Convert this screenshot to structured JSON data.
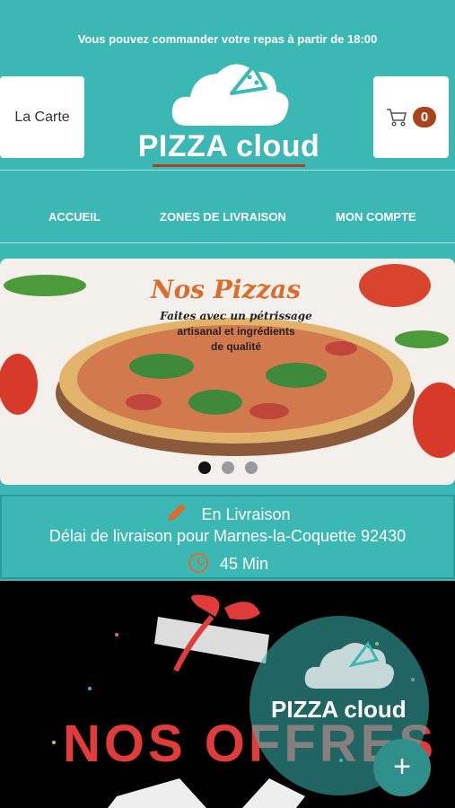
{
  "header": {
    "notice": "Vous pouvez commander votre repas à partir de 18:00",
    "menu_button": "La Carte",
    "cart_count": "0",
    "cart_icon": "cart-icon",
    "logo_text": "PIZZA cloud"
  },
  "nav": {
    "items": [
      {
        "label": "ACCUEIL"
      },
      {
        "label": "ZONES DE LIVRAISON"
      },
      {
        "label": "MON COMPTE"
      }
    ]
  },
  "banner": {
    "title": "Nos Pizzas",
    "subtitle_1": "Faites avec un pétrissage",
    "subtitle_2": "artisanal et ingrédients",
    "subtitle_3": "de qualité",
    "active_slide": 1,
    "slides": 3
  },
  "delivery": {
    "mode": "En Livraison",
    "delay_text": "Délai de livraison pour Marnes-la-Coquette 92430",
    "time": "45 Min"
  },
  "offers": {
    "title": "NOS OFFRES",
    "overlay_logo": "PIZZA cloud",
    "fab_label": "+"
  },
  "colors": {
    "brand": "#3cb8b4",
    "accent": "#a8431c"
  }
}
